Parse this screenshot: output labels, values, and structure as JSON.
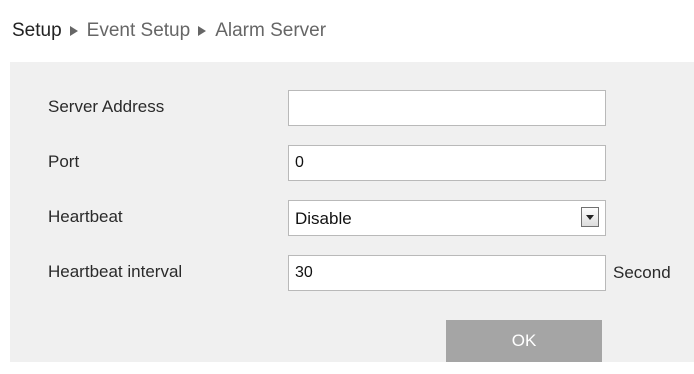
{
  "breadcrumb": {
    "root": "Setup",
    "items": [
      "Event Setup",
      "Alarm Server"
    ]
  },
  "form": {
    "server_address": {
      "label": "Server Address",
      "value": ""
    },
    "port": {
      "label": "Port",
      "value": "0"
    },
    "heartbeat": {
      "label": "Heartbeat",
      "selected": "Disable"
    },
    "heartbeat_interval": {
      "label": "Heartbeat interval",
      "value": "30",
      "unit": "Second"
    }
  },
  "actions": {
    "ok_label": "OK"
  }
}
